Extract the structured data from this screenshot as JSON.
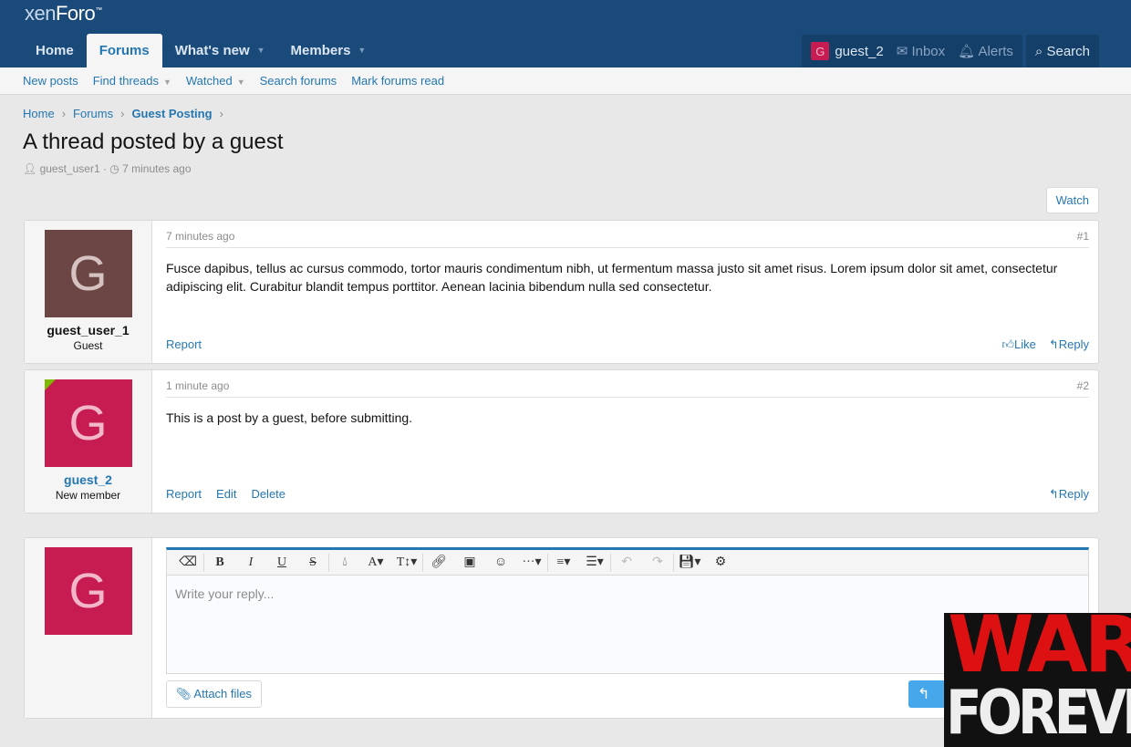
{
  "header": {
    "logo": "xenForo",
    "nav": [
      {
        "label": "Home"
      },
      {
        "label": "Forums"
      },
      {
        "label": "What's new"
      },
      {
        "label": "Members"
      }
    ],
    "user": {
      "avatar_letter": "G",
      "name": "guest_2"
    },
    "inbox": "Inbox",
    "alerts": "Alerts",
    "search": "Search"
  },
  "subnav": [
    "New posts",
    "Find threads",
    "Watched",
    "Search forums",
    "Mark forums read"
  ],
  "breadcrumbs": [
    "Home",
    "Forums",
    "Guest Posting"
  ],
  "thread": {
    "title": "A thread posted by a guest",
    "author": "guest_user1",
    "time": "7 minutes ago",
    "watch": "Watch"
  },
  "posts": [
    {
      "avatar": "G",
      "avatar_color": "#6b4644",
      "user": "guest_user_1",
      "title": "Guest",
      "time": "7 minutes ago",
      "num": "#1",
      "body": "Fusce dapibus, tellus ac cursus commodo, tortor mauris condimentum nibh, ut fermentum massa justo sit amet risus. Lorem ipsum dolor sit amet, consectetur adipiscing elit. Curabitur blandit tempus porttitor. Aenean lacinia bibendum nulla sed consectetur.",
      "report": "Report",
      "like": "Like",
      "reply": "Reply"
    },
    {
      "avatar": "G",
      "avatar_color": "#c71c52",
      "user": "guest_2",
      "title": "New member",
      "time": "1 minute ago",
      "num": "#2",
      "body": "This is a post by a guest, before submitting.",
      "report": "Report",
      "edit": "Edit",
      "delete": "Delete",
      "reply": "Reply"
    }
  ],
  "reply": {
    "avatar": "G",
    "placeholder": "Write your reply...",
    "attach": "Attach files"
  },
  "watermark": "WAR FOREVER"
}
